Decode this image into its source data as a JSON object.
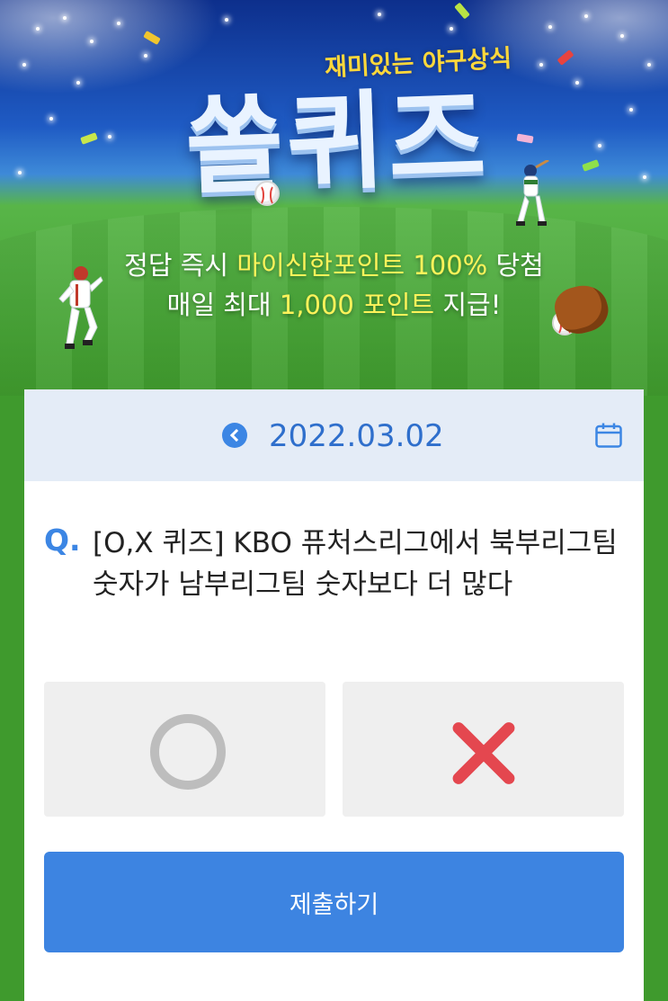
{
  "banner": {
    "subtitle": "재미있는 야구상식",
    "title": "쏠퀴즈",
    "promo_line1_prefix": "정답 즉시 ",
    "promo_line1_highlight": "마이신한포인트 100%",
    "promo_line1_suffix": " 당첨",
    "promo_line2_prefix": "매일 최대 ",
    "promo_line2_highlight": "1,000 포인트",
    "promo_line2_suffix": " 지급!"
  },
  "date_bar": {
    "prev_icon": "chevron-left-icon",
    "date": "2022.03.02",
    "calendar_icon": "calendar-icon"
  },
  "question": {
    "marker": "Q.",
    "text": "[O,X 퀴즈] KBO 퓨처스리그에서 북부리그팀 숫자가 남부리그팀 숫자보다 더 많다"
  },
  "answers": [
    {
      "id": "O",
      "icon": "circle-o-icon",
      "color": "#bdbdbd"
    },
    {
      "id": "X",
      "icon": "cross-x-icon",
      "color": "#e4474f"
    }
  ],
  "submit_label": "제출하기",
  "colors": {
    "accent": "#3d84e1",
    "date_bar_bg": "#e4ecf7",
    "highlight": "#fff35a",
    "field_green": "#3f9a2d"
  }
}
